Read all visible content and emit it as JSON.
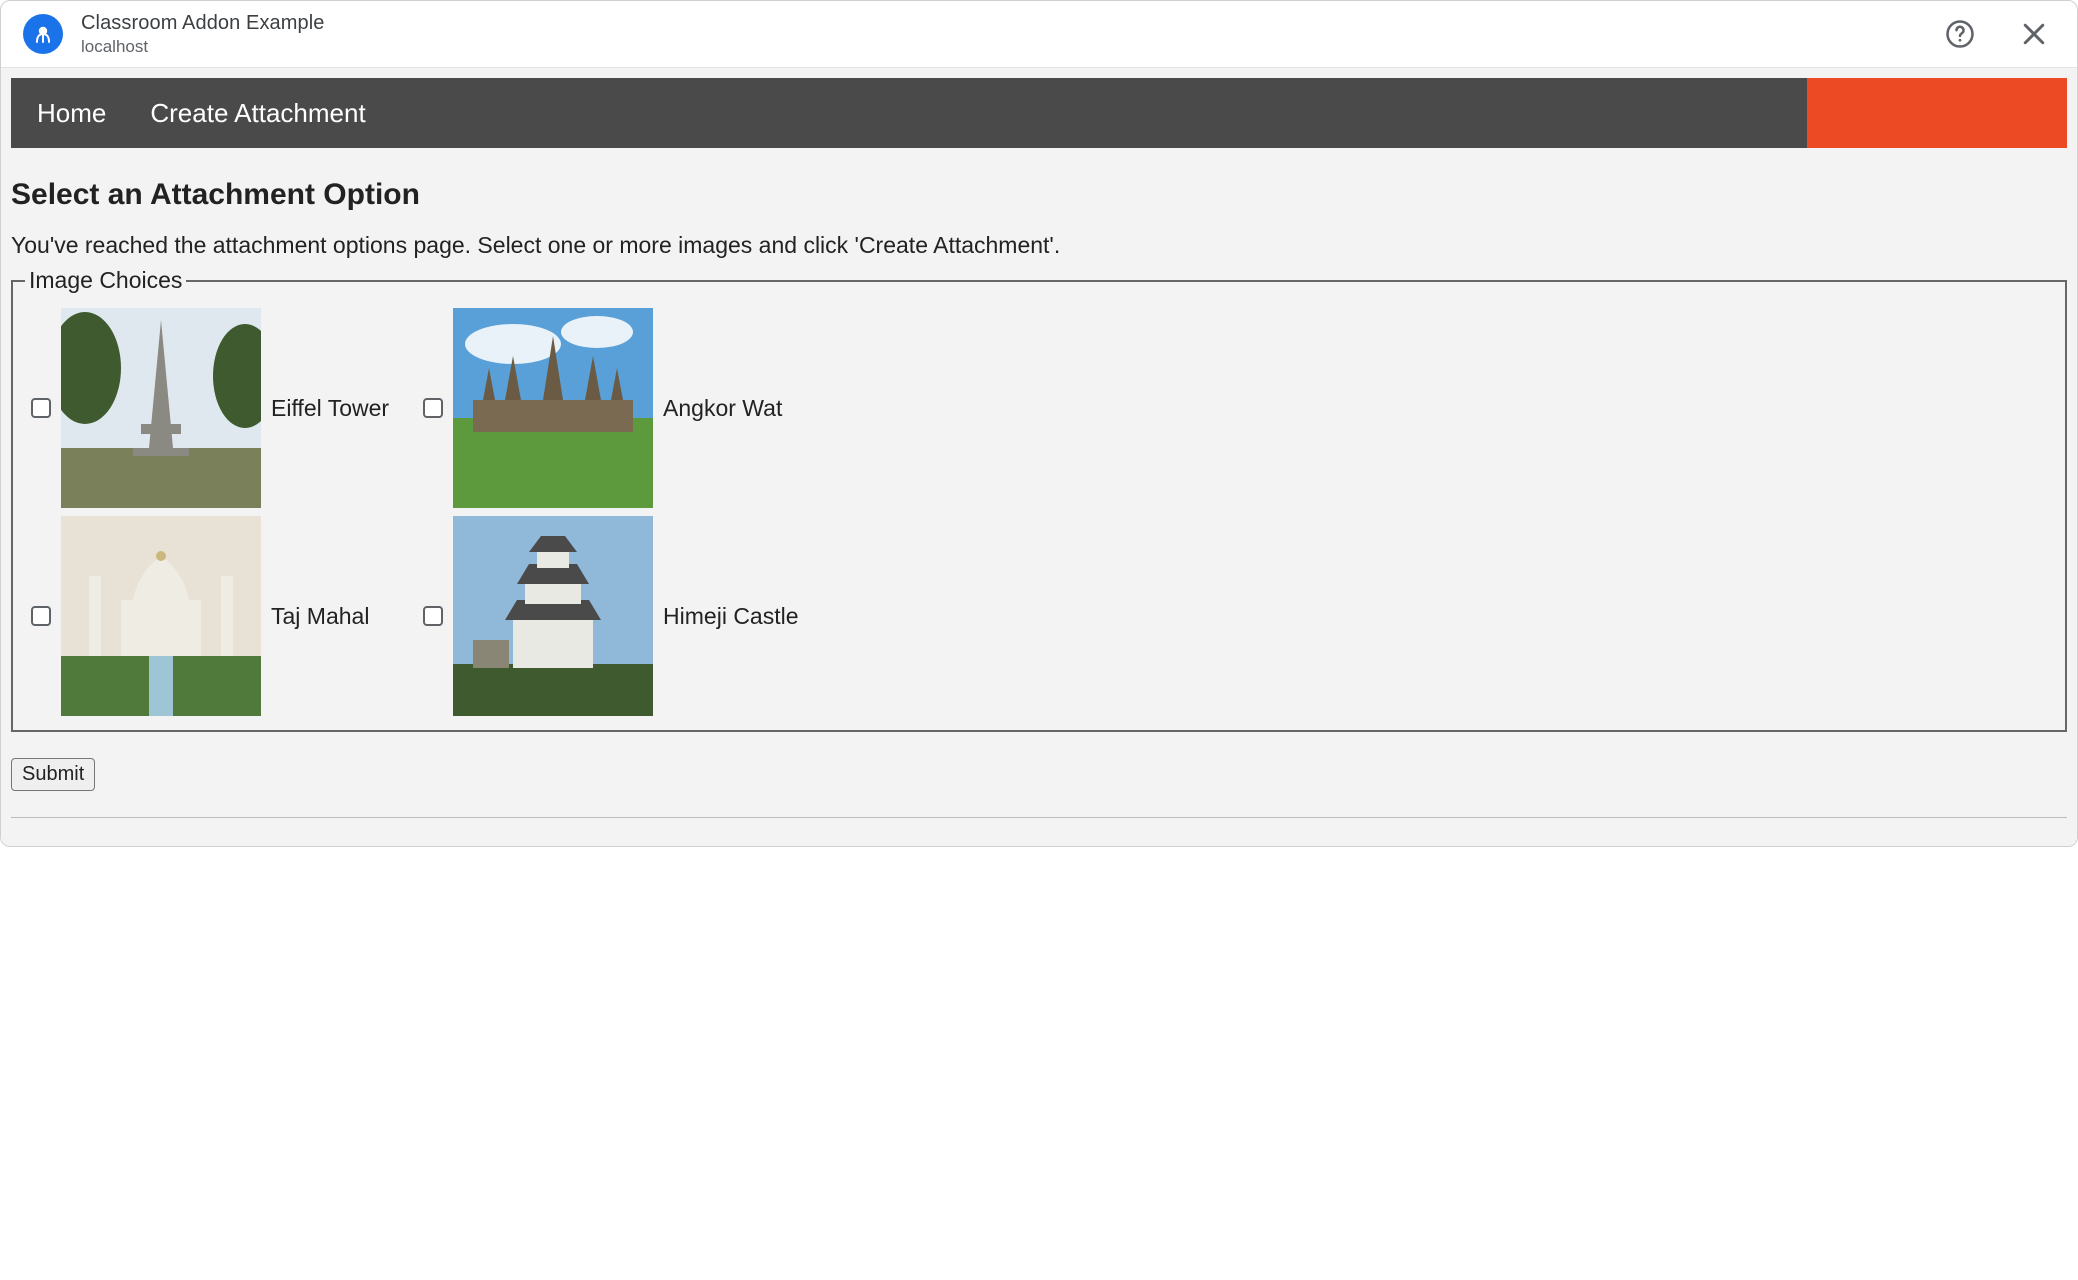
{
  "header": {
    "title": "Classroom Addon Example",
    "subtitle": "localhost"
  },
  "nav": {
    "home": "Home",
    "create_attachment": "Create Attachment"
  },
  "page": {
    "title": "Select an Attachment Option",
    "description": "You've reached the attachment options page. Select one or more images and click 'Create Attachment'."
  },
  "fieldset_legend": "Image Choices",
  "choices": [
    {
      "label": "Eiffel Tower"
    },
    {
      "label": "Angkor Wat"
    },
    {
      "label": "Taj Mahal"
    },
    {
      "label": "Himeji Castle"
    }
  ],
  "submit_label": "Submit"
}
